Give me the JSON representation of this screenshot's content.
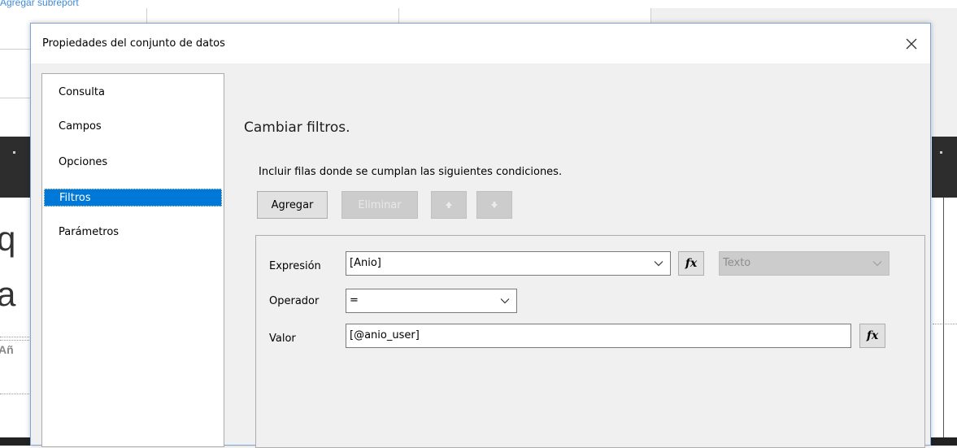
{
  "background": {
    "top_text": "Agregar subreport",
    "big_letters": [
      "q",
      "a"
    ],
    "small_text": "Añ"
  },
  "dialog": {
    "title": "Propiedades del conjunto de datos",
    "close_label": "×",
    "nav_items": [
      "Consulta",
      "Campos",
      "Opciones",
      "Filtros",
      "Parámetros"
    ],
    "selected_nav": "Filtros",
    "section_title": "Cambiar filtros.",
    "instruction": "Incluir filas donde se cumplan las siguientes condiciones.",
    "buttons": {
      "add": "Agregar",
      "delete": "Eliminar"
    },
    "filter": {
      "expression_label": "Expresión",
      "expression_value": "[Anio]",
      "type_value": "Texto",
      "operator_label": "Operador",
      "operator_value": "=",
      "value_label": "Valor",
      "value_value": "[@anio_user]",
      "fx_label": "fx"
    }
  },
  "colors": {
    "accent": "#0078d7",
    "dialog_bg": "#f0f0f0",
    "border": "#7aa7d6"
  }
}
